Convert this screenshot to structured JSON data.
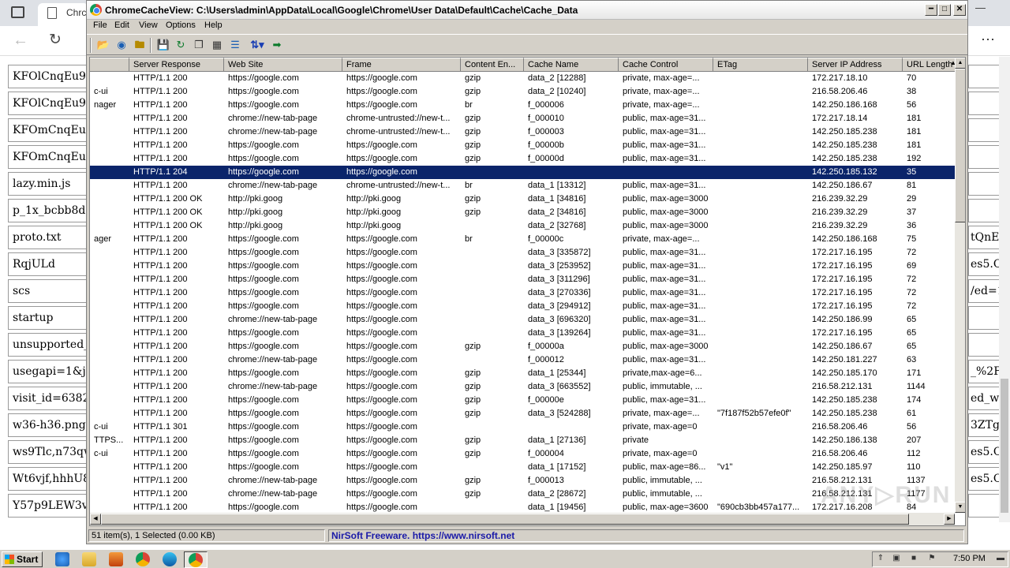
{
  "background_browser": {
    "tab_title": "Chrc",
    "left_items": [
      "KFOlCnqEu92",
      "KFOlCnqEu92",
      "KFOmCnqEu9",
      "KFOmCnqEu9",
      "lazy.min.js",
      "p_1x_bcbb8de",
      "proto.txt",
      "RqjULd",
      "scs",
      "startup",
      "unsupported_w",
      "usegapi=1&jsh",
      "visit_id=63825",
      "w36-h36.png",
      "ws9Tlc,n73qw",
      "Wt6vjf,hhhU8,",
      "Y57p9LEW3v"
    ],
    "right_items": [
      "",
      "",
      "",
      "",
      "",
      "",
      "tQnEh",
      "es5.O",
      "/ed=1",
      "",
      "",
      "_%2F",
      "ed_w",
      "3ZTg",
      "es5.O",
      "es5.O",
      ""
    ]
  },
  "window": {
    "title": "ChromeCacheView:  C:\\Users\\admin\\AppData\\Local\\Google\\Chrome\\User Data\\Default\\Cache\\Cache_Data",
    "menu": [
      "File",
      "Edit",
      "View",
      "Options",
      "Help"
    ],
    "toolbar_icons": [
      "open-folder-icon",
      "globe-icon",
      "select-folder-icon",
      "save-icon",
      "refresh-icon",
      "copy-icon",
      "properties-icon",
      "sort-icon",
      "exit-icon"
    ],
    "columns": [
      "",
      "Server Response",
      "Web Site",
      "Frame",
      "Content En...",
      "Cache Name",
      "Cache Control",
      "ETag",
      "Server IP Address",
      "URL Length"
    ],
    "rows": [
      [
        "",
        "HTTP/1.1 200",
        "https://google.com",
        "https://google.com",
        "gzip",
        "data_2  [12288]",
        "private, max-age=...",
        "",
        "172.217.18.10",
        "70"
      ],
      [
        "c-ui",
        "HTTP/1.1 200",
        "https://google.com",
        "https://google.com",
        "gzip",
        "data_2  [10240]",
        "private, max-age=...",
        "",
        "216.58.206.46",
        "38"
      ],
      [
        "nager",
        "HTTP/1.1 200",
        "https://google.com",
        "https://google.com",
        "br",
        "f_000006",
        "private, max-age=...",
        "",
        "142.250.186.168",
        "56"
      ],
      [
        "",
        "HTTP/1.1 200",
        "chrome://new-tab-page",
        "chrome-untrusted://new-t...",
        "gzip",
        "f_000010",
        "public, max-age=31...",
        "",
        "172.217.18.14",
        "181"
      ],
      [
        "",
        "HTTP/1.1 200",
        "chrome://new-tab-page",
        "chrome-untrusted://new-t...",
        "gzip",
        "f_000003",
        "public, max-age=31...",
        "",
        "142.250.185.238",
        "181"
      ],
      [
        "",
        "HTTP/1.1 200",
        "https://google.com",
        "https://google.com",
        "gzip",
        "f_00000b",
        "public, max-age=31...",
        "",
        "142.250.185.238",
        "181"
      ],
      [
        "",
        "HTTP/1.1 200",
        "https://google.com",
        "https://google.com",
        "gzip",
        "f_00000d",
        "public, max-age=31...",
        "",
        "142.250.185.238",
        "192"
      ],
      [
        "",
        "HTTP/1.1 204",
        "https://google.com",
        "https://google.com",
        "",
        "",
        "",
        "",
        "142.250.185.132",
        "35"
      ],
      [
        "",
        "HTTP/1.1 200",
        "chrome://new-tab-page",
        "chrome-untrusted://new-t...",
        "br",
        "data_1  [13312]",
        "public, max-age=31...",
        "",
        "142.250.186.67",
        "81"
      ],
      [
        "",
        "HTTP/1.1 200 OK",
        "http://pki.goog",
        "http://pki.goog",
        "gzip",
        "data_1  [34816]",
        "public, max-age=3000",
        "",
        "216.239.32.29",
        "29"
      ],
      [
        "",
        "HTTP/1.1 200 OK",
        "http://pki.goog",
        "http://pki.goog",
        "gzip",
        "data_2  [34816]",
        "public, max-age=3000",
        "",
        "216.239.32.29",
        "37"
      ],
      [
        "",
        "HTTP/1.1 200 OK",
        "http://pki.goog",
        "http://pki.goog",
        "",
        "data_2  [32768]",
        "public, max-age=3000",
        "",
        "216.239.32.29",
        "36"
      ],
      [
        "ager",
        "HTTP/1.1 200",
        "https://google.com",
        "https://google.com",
        "br",
        "f_00000c",
        "private, max-age=...",
        "",
        "142.250.186.168",
        "75"
      ],
      [
        "",
        "HTTP/1.1 200",
        "https://google.com",
        "https://google.com",
        "",
        "data_3  [335872]",
        "public, max-age=31...",
        "",
        "172.217.16.195",
        "72"
      ],
      [
        "",
        "HTTP/1.1 200",
        "https://google.com",
        "https://google.com",
        "",
        "data_3  [253952]",
        "public, max-age=31...",
        "",
        "172.217.16.195",
        "69"
      ],
      [
        "",
        "HTTP/1.1 200",
        "https://google.com",
        "https://google.com",
        "",
        "data_3  [311296]",
        "public, max-age=31...",
        "",
        "172.217.16.195",
        "72"
      ],
      [
        "",
        "HTTP/1.1 200",
        "https://google.com",
        "https://google.com",
        "",
        "data_3  [270336]",
        "public, max-age=31...",
        "",
        "172.217.16.195",
        "72"
      ],
      [
        "",
        "HTTP/1.1 200",
        "https://google.com",
        "https://google.com",
        "",
        "data_3  [294912]",
        "public, max-age=31...",
        "",
        "172.217.16.195",
        "72"
      ],
      [
        "",
        "HTTP/1.1 200",
        "chrome://new-tab-page",
        "https://google.com",
        "",
        "data_3  [696320]",
        "public, max-age=31...",
        "",
        "142.250.186.99",
        "65"
      ],
      [
        "",
        "HTTP/1.1 200",
        "https://google.com",
        "https://google.com",
        "",
        "data_3  [139264]",
        "public, max-age=31...",
        "",
        "172.217.16.195",
        "65"
      ],
      [
        "",
        "HTTP/1.1 200",
        "https://google.com",
        "https://google.com",
        "gzip",
        "f_00000a",
        "public, max-age=3000",
        "",
        "142.250.186.67",
        "65"
      ],
      [
        "",
        "HTTP/1.1 200",
        "chrome://new-tab-page",
        "https://google.com",
        "",
        "f_000012",
        "public, max-age=31...",
        "",
        "142.250.181.227",
        "63"
      ],
      [
        "",
        "HTTP/1.1 200",
        "https://google.com",
        "https://google.com",
        "gzip",
        "data_1  [25344]",
        "private,max-age=6...",
        "",
        "142.250.185.170",
        "171"
      ],
      [
        "",
        "HTTP/1.1 200",
        "chrome://new-tab-page",
        "https://google.com",
        "gzip",
        "data_3  [663552]",
        "public, immutable, ...",
        "",
        "216.58.212.131",
        "1144"
      ],
      [
        "",
        "HTTP/1.1 200",
        "https://google.com",
        "https://google.com",
        "gzip",
        "f_00000e",
        "public, max-age=31...",
        "",
        "142.250.185.238",
        "174"
      ],
      [
        "",
        "HTTP/1.1 200",
        "https://google.com",
        "https://google.com",
        "gzip",
        "data_3  [524288]",
        "private, max-age=...",
        "\"7f187f52b57efe0f\"",
        "142.250.185.238",
        "61"
      ],
      [
        "c-ui",
        "HTTP/1.1 301",
        "https://google.com",
        "https://google.com",
        "",
        "",
        "private, max-age=0",
        "",
        "216.58.206.46",
        "56"
      ],
      [
        "TTPS...",
        "HTTP/1.1 200",
        "https://google.com",
        "https://google.com",
        "gzip",
        "data_1  [27136]",
        "private",
        "",
        "142.250.186.138",
        "207"
      ],
      [
        "c-ui",
        "HTTP/1.1 200",
        "https://google.com",
        "https://google.com",
        "gzip",
        "f_000004",
        "private, max-age=0",
        "",
        "216.58.206.46",
        "112"
      ],
      [
        "",
        "HTTP/1.1 200",
        "https://google.com",
        "https://google.com",
        "",
        "data_1  [17152]",
        "public, max-age=86...",
        "\"v1\"",
        "142.250.185.97",
        "110"
      ],
      [
        "",
        "HTTP/1.1 200",
        "chrome://new-tab-page",
        "https://google.com",
        "gzip",
        "f_000013",
        "public, immutable, ...",
        "",
        "216.58.212.131",
        "1137"
      ],
      [
        "",
        "HTTP/1.1 200",
        "chrome://new-tab-page",
        "https://google.com",
        "gzip",
        "data_2  [28672]",
        "public, immutable, ...",
        "",
        "216.58.212.131",
        "1177"
      ],
      [
        "",
        "HTTP/1.1 200",
        "https://google.com",
        "https://google.com",
        "",
        "data_1  [19456]",
        "public, max-age=3600",
        "\"690cb3bb457a177...",
        "172.217.16.208",
        "84"
      ]
    ],
    "selected_row_index": 7,
    "status_left": "51 item(s), 1 Selected  (0.00 KB)",
    "status_link": "NirSoft Freeware. https://www.nirsoft.net"
  },
  "taskbar": {
    "start_label": "Start",
    "time": "7:50 PM"
  },
  "colors": {
    "selection": "#0a246a",
    "window_face": "#d4d0c8",
    "link": "#1a1aa8"
  }
}
